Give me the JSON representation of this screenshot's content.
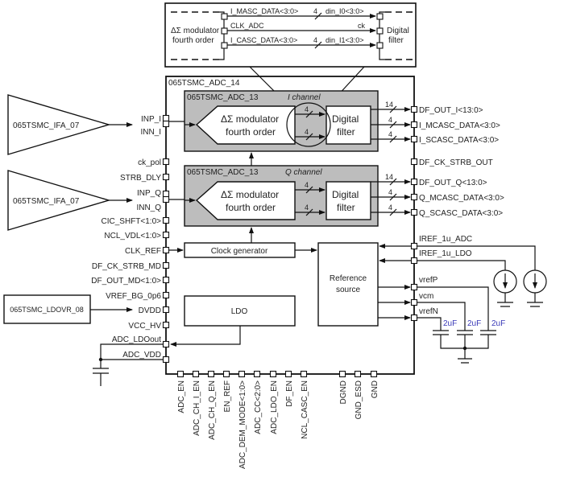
{
  "zoom_inset": {
    "left_block": [
      "ΔΣ modulator",
      "fourth order"
    ],
    "right_block": [
      "Digital",
      "filter"
    ],
    "signals": [
      {
        "src": "I_MASC_DATA<3:0>",
        "width": "4",
        "dst": "din_I0<3:0>"
      },
      {
        "src": "CLK_ADC",
        "dst": "ck"
      },
      {
        "src": "I_CASC_DATA<3:0>",
        "width": "4",
        "dst": "din_I1<3:0>"
      }
    ]
  },
  "top_block": {
    "name": "065TSMC_ADC_14"
  },
  "i_channel": {
    "name": "065TSMC_ADC_13",
    "label": "I channel",
    "modulator": [
      "ΔΣ modulator",
      "fourth order"
    ],
    "filter": [
      "Digital",
      "filter"
    ],
    "bus_widths": [
      "4",
      "4"
    ],
    "out_widths": [
      "14",
      "4",
      "4"
    ]
  },
  "q_channel": {
    "name": "065TSMC_ADC_13",
    "label": "Q channel",
    "modulator": [
      "ΔΣ modulator",
      "fourth order"
    ],
    "filter": [
      "Digital",
      "filter"
    ],
    "bus_widths": [
      "4",
      "4"
    ],
    "out_widths": [
      "14",
      "4",
      "4"
    ]
  },
  "clock_generator": "Clock generator",
  "reference_source": [
    "Reference",
    "source"
  ],
  "ldo": "LDO",
  "amplifiers": [
    "065TSMC_IFA_07",
    "065TSMC_IFA_07"
  ],
  "ldovr": "065TSMC_LDOVR_08",
  "left_pins": [
    "INP_I",
    "INN_I",
    "ck_pol",
    "STRB_DLY",
    "INP_Q",
    "INN_Q",
    "CIC_SHFT<1:0>",
    "NCL_VDL<1:0>",
    "CLK_REF",
    "DF_CK_STRB_MD",
    "DF_OUT_MD<1:0>",
    "VREF_BG_0p6",
    "DVDD",
    "VCC_HV",
    "ADC_LDOout",
    "ADC_VDD"
  ],
  "right_pins": [
    "DF_OUT_I<13:0>",
    "I_MCASC_DATA<3:0>",
    "I_SCASC_DATA<3:0>",
    "DF_CK_STRB_OUT",
    "DF_OUT_Q<13:0>",
    "Q_MCASC_DATA<3:0>",
    "Q_SCASC_DATA<3:0>",
    "IREF_1u_ADC",
    "IREF_1u_LDO",
    "vrefP",
    "vcm",
    "vrefN"
  ],
  "bottom_pins": [
    "ADC_EN",
    "ADC_CH_I_EN",
    "ADC_CH_Q_EN",
    "EN_REF",
    "ADC_DEM_MODE<1:0>",
    "ADC_CC<2:0>",
    "ADC_LDO_EN",
    "DF_EN",
    "NCL_CASC_EN",
    "DGND",
    "GND_ESD",
    "GND"
  ],
  "capacitors": [
    "2uF",
    "2uF",
    "2uF"
  ],
  "colors": {
    "block_fill": "#bdbdbd",
    "capacitor_label": "#3a3ab8"
  }
}
